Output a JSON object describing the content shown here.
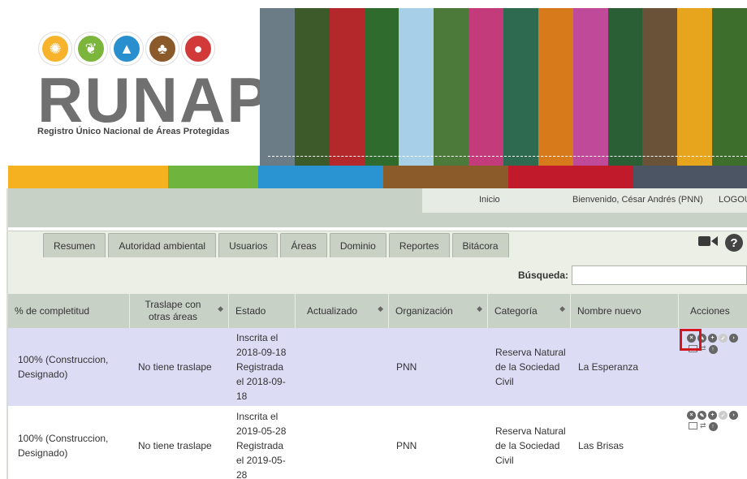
{
  "header": {
    "logo_text": "RUNAP",
    "logo_subtitle": "Registro Único Nacional de Áreas Protegidas",
    "logo_circle_colors": [
      "#f7b32b",
      "#7bb53b",
      "#2a8fcf",
      "#8b5a2b",
      "#d23a3a"
    ],
    "banner_colors": [
      "#6b7c87",
      "#3d5a2a",
      "#b4272a",
      "#2e6b2c",
      "#a7cfe8",
      "#4c7a3b",
      "#c33b7a",
      "#2d6a4f",
      "#d77a1c",
      "#c04a9a",
      "#2a5e34",
      "#6a5239",
      "#e7a51e",
      "#3e6e2c"
    ]
  },
  "colorbar": [
    "#f5b11f",
    "#6fb43d",
    "#2a94d2",
    "#8c5b2a",
    "#c11a2b",
    "#4b5563"
  ],
  "nav": {
    "inicio": "Inicio",
    "welcome": "Bienvenido, César Andrés (PNN)",
    "logout": "LOGOUT"
  },
  "tabs": [
    "Resumen",
    "Autoridad ambiental",
    "Usuarios",
    "Áreas",
    "Dominio",
    "Reportes",
    "Bitácora"
  ],
  "search": {
    "label": "Búsqueda:",
    "value": ""
  },
  "table": {
    "columns": [
      "% de completitud",
      "Traslape con otras áreas",
      "Estado",
      "Actualizado",
      "Organización",
      "Categoría",
      "Nombre nuevo",
      "Acciones"
    ],
    "rows": [
      {
        "completitud": "100% (Construccion, Designado)",
        "traslape": "No tiene traslape",
        "estado": "Inscrita el 2018-09-18 Registrada el 2018-09-18",
        "actualizado": "",
        "organizacion": "PNN",
        "categoria": "Reserva Natural de la Sociedad Civil",
        "nombre": "La Esperanza"
      },
      {
        "completitud": "100% (Construccion, Designado)",
        "traslape": "No tiene traslape",
        "estado": "Inscrita el 2019-05-28 Registrada el 2019-05-28",
        "actualizado": "",
        "organizacion": "PNN",
        "categoria": "Reserva Natural de la Sociedad Civil",
        "nombre": "Las Brisas"
      }
    ]
  },
  "colors": {
    "accent_highlight": "#d0181f",
    "selected_row": "#dcdcf5",
    "header_bg": "#c7d1c6"
  }
}
